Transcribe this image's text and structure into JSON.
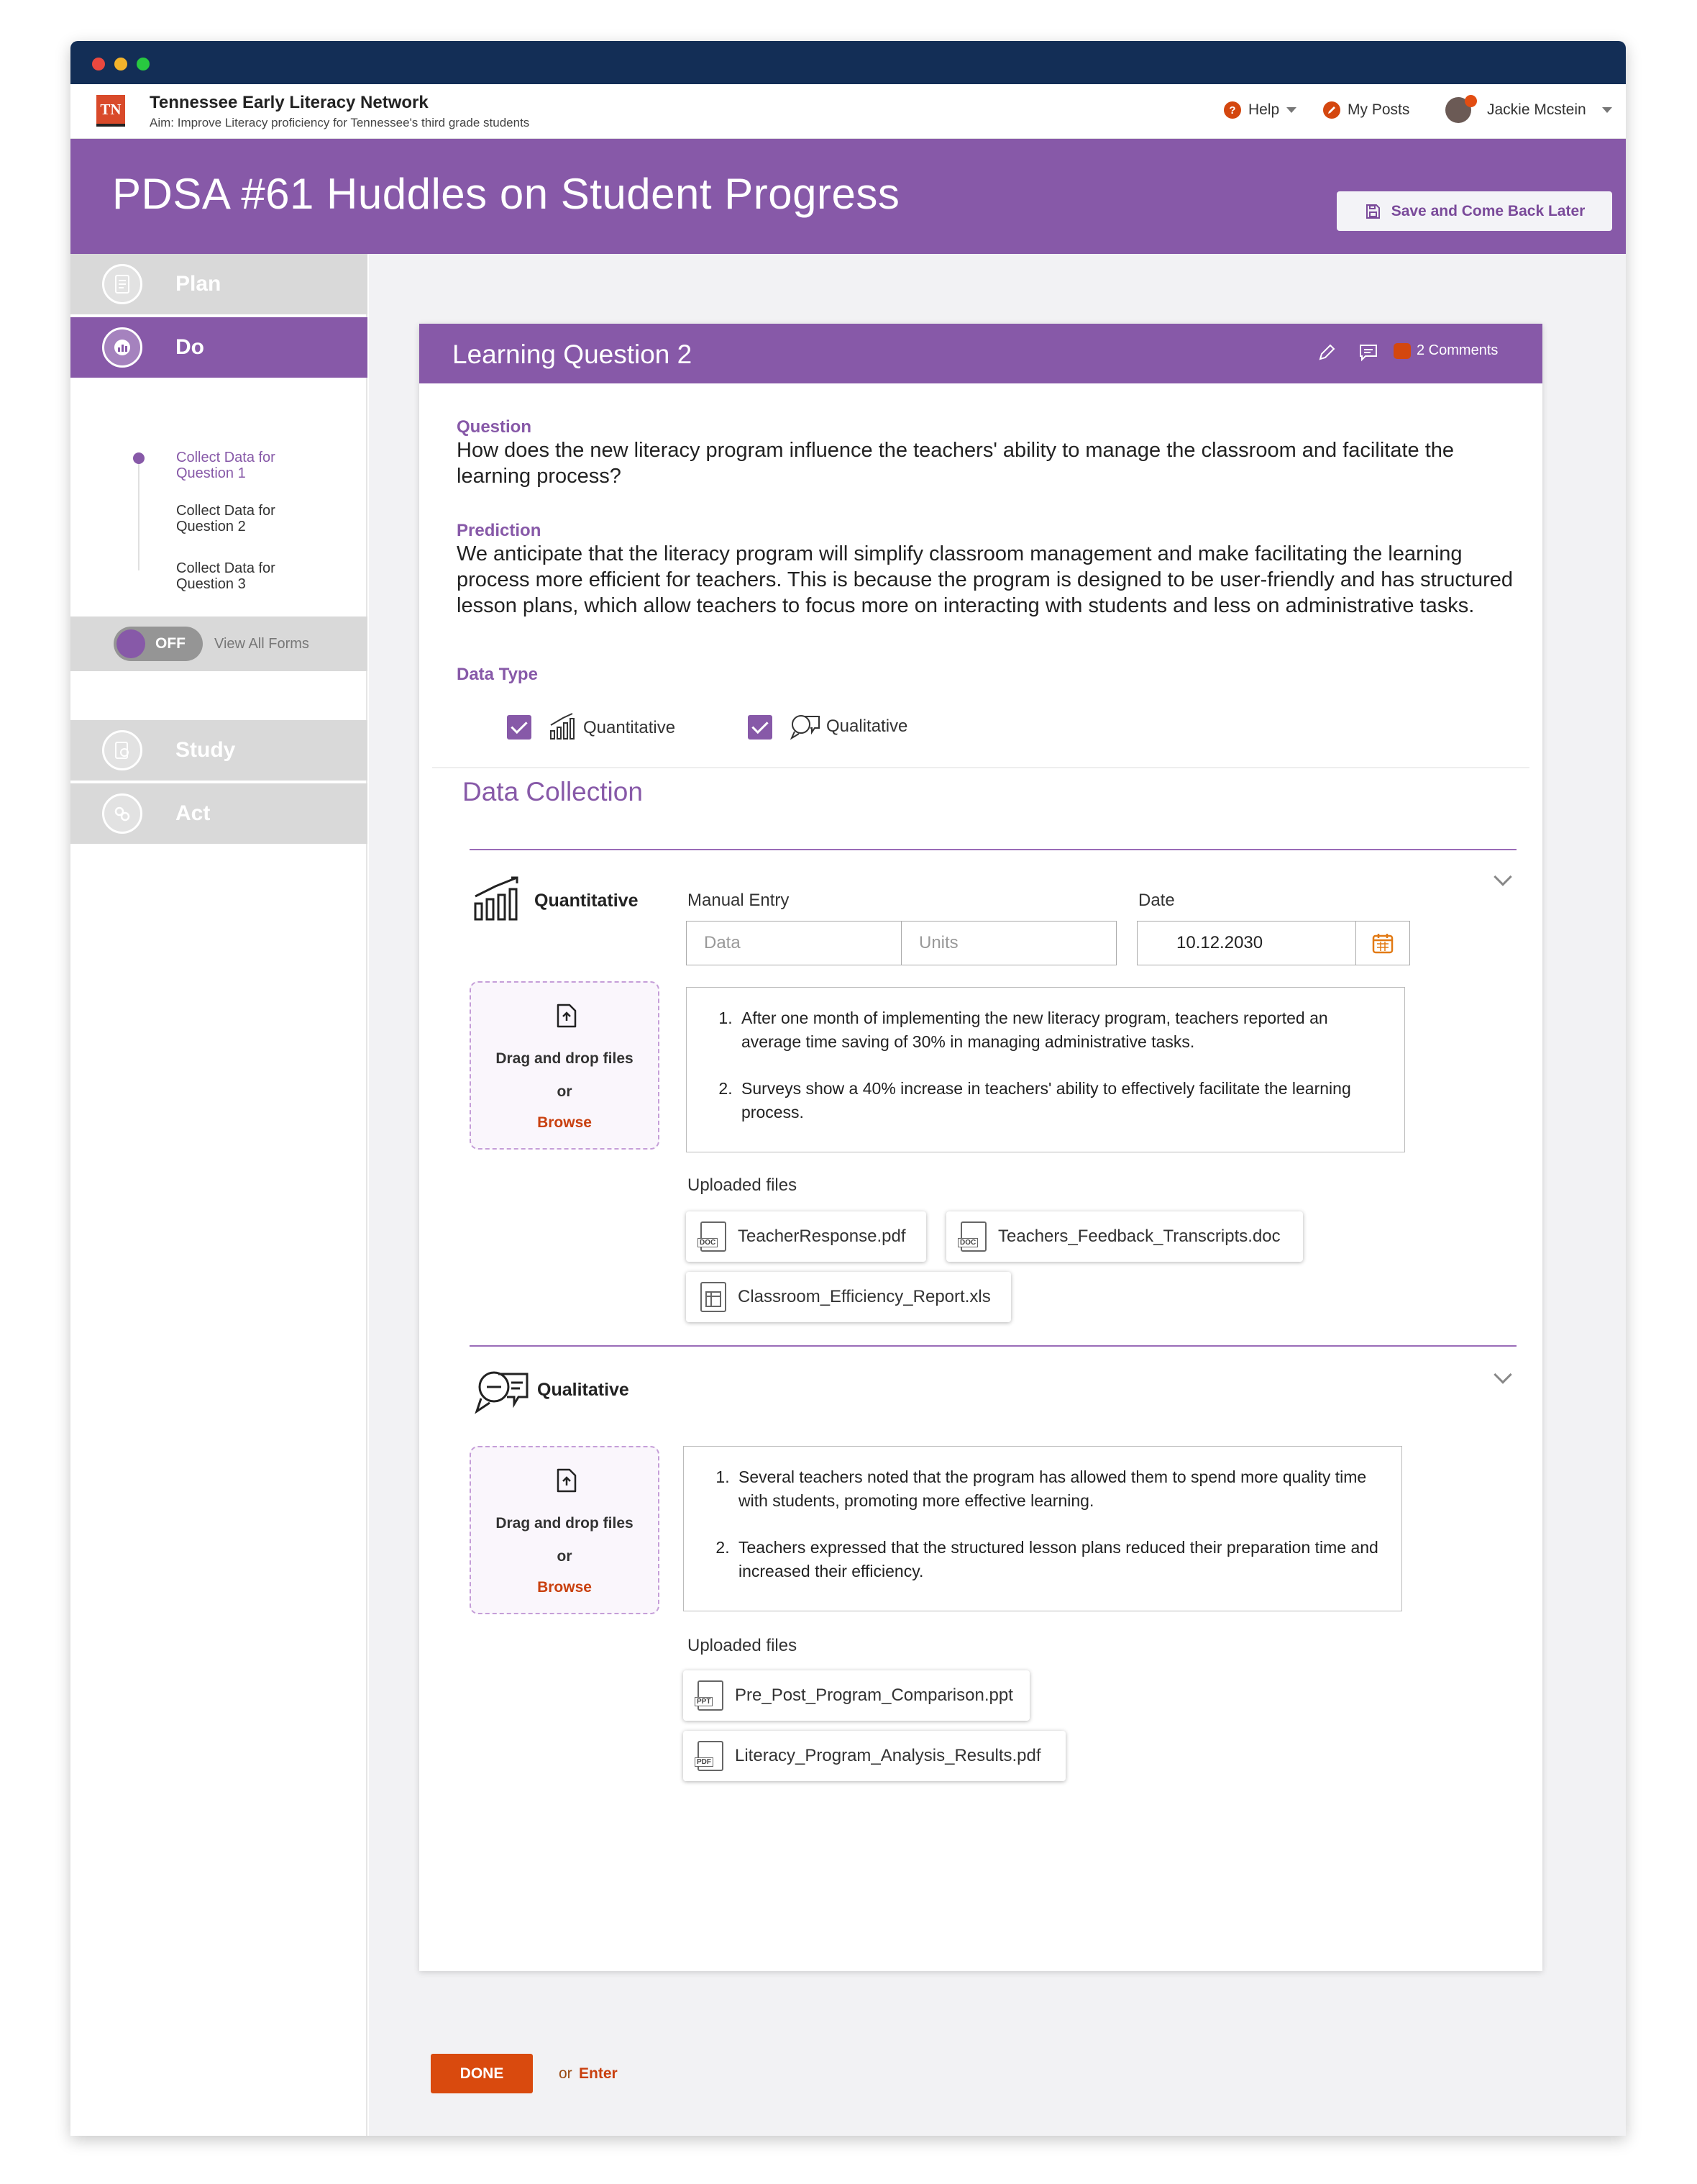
{
  "app": {
    "logo_text": "TN",
    "org_name": "Tennessee Early Literacy Network",
    "org_aim": "Aim: Improve Literacy proficiency for Tennessee's third grade students"
  },
  "nav": {
    "help": "Help",
    "help_badge": "?",
    "my_posts": "My Posts",
    "user": "Jackie Mcstein"
  },
  "hero": {
    "title": "PDSA #61 Huddles on Student Progress",
    "save_label": "Save and Come Back Later"
  },
  "sidebar": {
    "steps": {
      "plan": "Plan",
      "do": "Do",
      "study": "Study",
      "act": "Act"
    },
    "sub_items": [
      "Collect Data for Question 1",
      "Collect Data for Question 2",
      "Collect Data for Question 3"
    ],
    "toggle_state": "OFF",
    "toggle_label": "View All Forms"
  },
  "card": {
    "title": "Learning Question 2",
    "comments": "2 Comments",
    "question_label": "Question",
    "question_text": "How does the new literacy program influence the teachers' ability to manage the classroom and facilitate the learning process?",
    "prediction_label": "Prediction",
    "prediction_text": "We anticipate that the literacy program will simplify classroom management and make facilitating the learning process more efficient for teachers. This is because the program is designed to be user-friendly and has structured lesson plans, which allow teachers to focus more on interacting with students and less on administrative tasks.",
    "data_type_label": "Data Type",
    "data_types": [
      "Quantitative",
      "Qualitative"
    ]
  },
  "data_collection": {
    "title": "Data Collection",
    "quantitative": {
      "title": "Quantitative",
      "manual_entry_label": "Manual Entry",
      "data_placeholder": "Data",
      "units_placeholder": "Units",
      "date_label": "Date",
      "date_value": "10.12.2030",
      "dropzone": {
        "text": "Drag and drop files",
        "or": "or",
        "browse": "Browse"
      },
      "notes": [
        "After one month of implementing the new literacy program, teachers reported an average time saving of 30% in managing administrative tasks.",
        "Surveys show a 40% increase in teachers' ability to effectively facilitate the learning process."
      ],
      "uploaded_label": "Uploaded files",
      "files": [
        "TeacherResponse.pdf",
        "Teachers_Feedback_Transcripts.doc",
        "Classroom_Efficiency_Report.xls"
      ],
      "file_tags": [
        "DOC",
        "DOC",
        ""
      ]
    },
    "qualitative": {
      "title": "Qualitative",
      "dropzone": {
        "text": "Drag and drop files",
        "or": "or",
        "browse": "Browse"
      },
      "notes": [
        "Several teachers noted that the program has allowed them to spend more quality time with students, promoting more effective learning.",
        "Teachers expressed that the structured lesson plans reduced their preparation time and increased their efficiency."
      ],
      "uploaded_label": "Uploaded files",
      "files": [
        "Pre_Post_Program_Comparison.ppt",
        "Literacy_Program_Analysis_Results.pdf"
      ],
      "file_tags": [
        "PPT",
        "PDF"
      ]
    }
  },
  "footer": {
    "done": "DONE",
    "or": "or",
    "enter": "Enter"
  },
  "colors": {
    "brand_purple": "#8759a8",
    "accent_orange": "#d94a0e",
    "titlebar": "#132e56"
  }
}
